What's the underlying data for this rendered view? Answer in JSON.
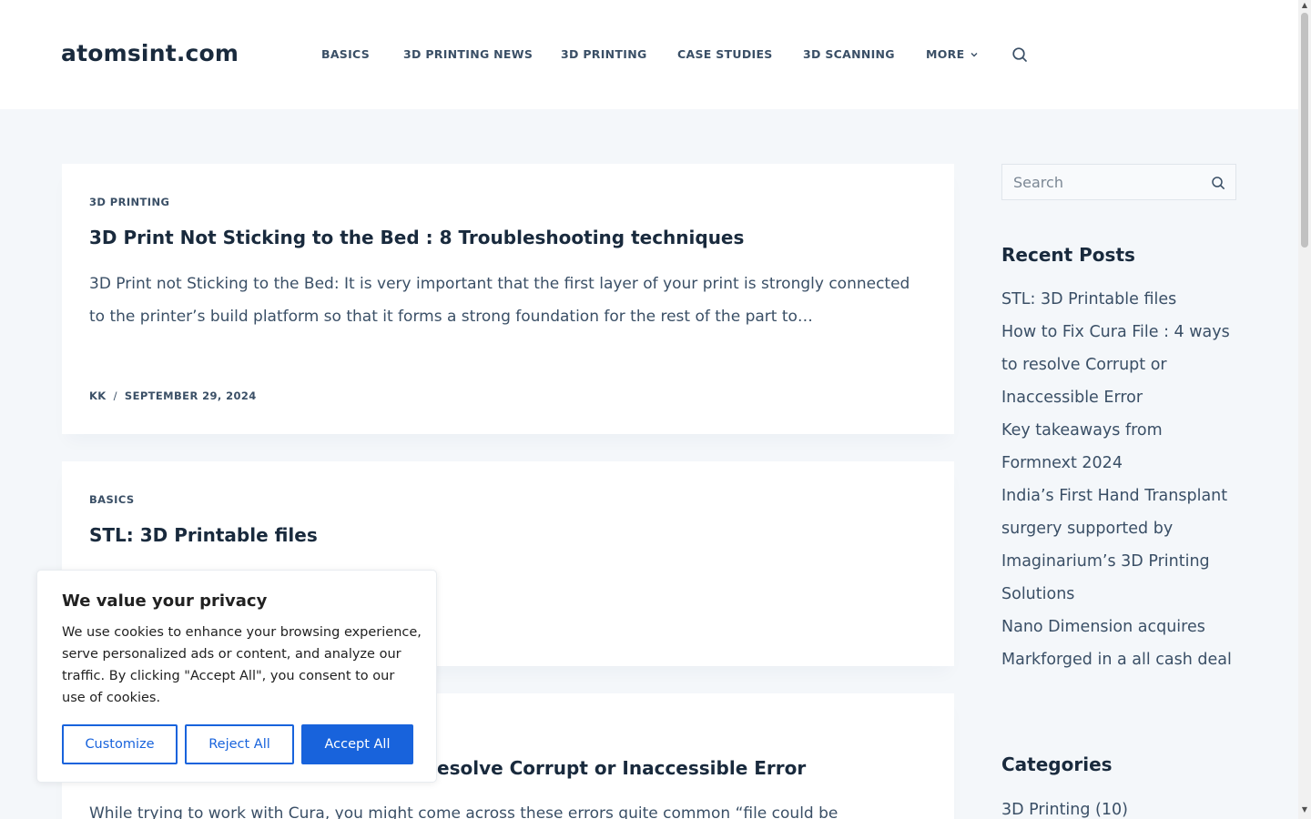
{
  "site": {
    "logo": "atomsint.com"
  },
  "nav": {
    "items": [
      "BASICS",
      "3D PRINTING NEWS",
      "3D PRINTING",
      "CASE STUDIES",
      "3D SCANNING"
    ],
    "more_label": "MORE"
  },
  "posts": [
    {
      "category": "3D PRINTING",
      "title": "3D Print Not Sticking to the Bed : 8 Troubleshooting techniques",
      "excerpt": "3D Print not Sticking to the Bed: It is very important that the first layer of your print is strongly connected to the printer’s build platform so that it forms a strong foundation for the rest of the part to…",
      "author": "KK",
      "date": "SEPTEMBER 29, 2024"
    },
    {
      "category": "BASICS",
      "title": "STL: 3D Printable files"
    },
    {
      "title_visible": "esolve Corrupt or Inaccessible Error",
      "excerpt_visible": "While trying to work with Cura, you might come across these errors quite common “file could be"
    }
  ],
  "sidebar": {
    "search_placeholder": "Search",
    "recent_title": "Recent Posts",
    "recent_posts": [
      "STL: 3D Printable files",
      "How to Fix Cura File : 4 ways to resolve Corrupt or Inaccessible Error",
      "Key takeaways from Formnext 2024",
      "India’s First Hand Transplant surgery supported by Imaginarium’s 3D Printing Solutions",
      "Nano Dimension acquires Markforged in a all cash deal"
    ],
    "categories_title": "Categories",
    "categories": [
      "3D Printing (10)"
    ]
  },
  "cookie": {
    "title": "We value your privacy",
    "text": "We use cookies to enhance your browsing experience, serve personalized ads or content, and analyze our traffic. By clicking \"Accept All\", you consent to our use of cookies.",
    "customize": "Customize",
    "reject": "Reject All",
    "accept": "Accept All"
  },
  "colors": {
    "heading": "#192a3d",
    "text": "#3a4f66",
    "page_bg": "#f4f7fa",
    "cookie_accent": "#1863dc"
  }
}
